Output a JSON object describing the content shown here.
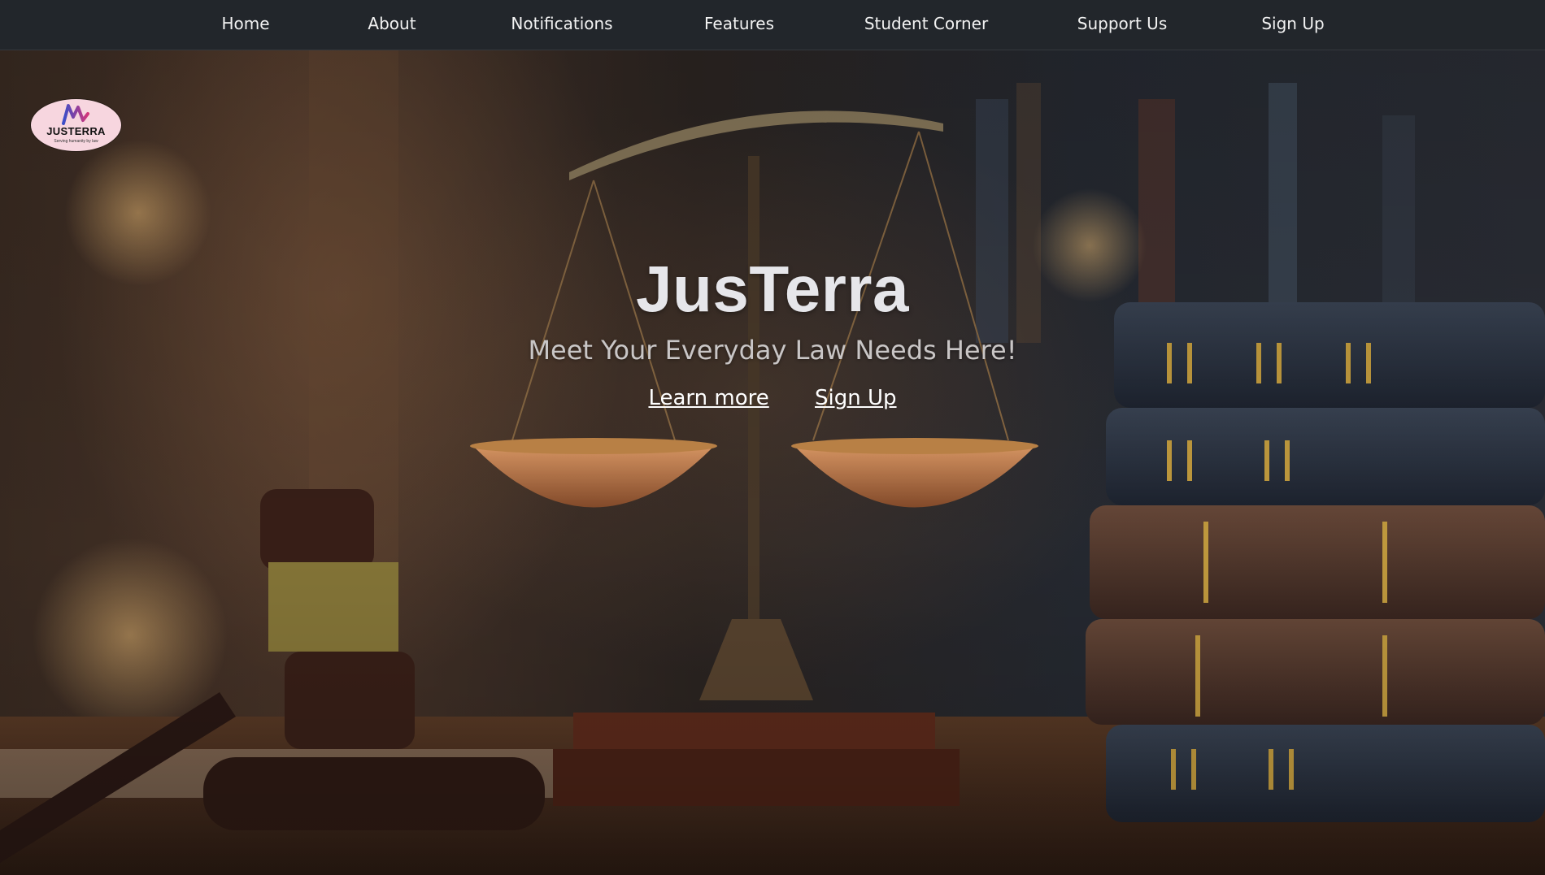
{
  "nav": {
    "items": [
      {
        "label": "Home"
      },
      {
        "label": "About"
      },
      {
        "label": "Notifications"
      },
      {
        "label": "Features"
      },
      {
        "label": "Student Corner"
      },
      {
        "label": "Support Us"
      },
      {
        "label": "Sign Up"
      }
    ]
  },
  "logo": {
    "text": "JUSTERRA",
    "tagline": "Serving humanity by law"
  },
  "hero": {
    "title": "JusTerra",
    "subtitle": "Meet Your Everyday Law Needs Here!",
    "learn_more": "Learn more",
    "sign_up": "Sign Up"
  },
  "colors": {
    "nav_background": "#22262b",
    "nav_text": "#f2f2f2",
    "logo_background": "#f7d6df",
    "title": "#e6e6ea",
    "subtitle": "#c9c6c6"
  }
}
